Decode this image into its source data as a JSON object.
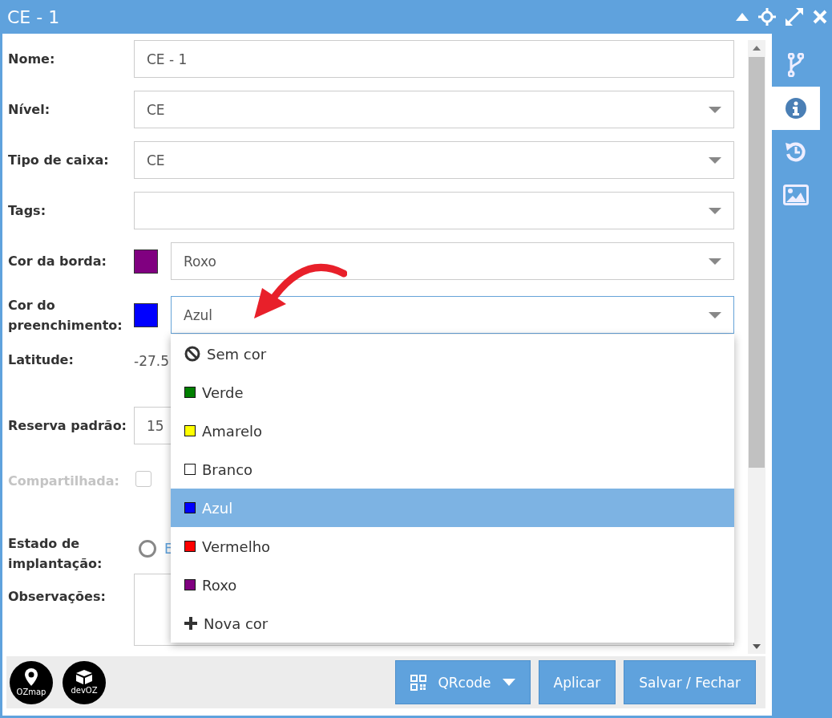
{
  "window": {
    "title": "CE - 1"
  },
  "fields": [
    {
      "label": "Nome:",
      "kind": "text",
      "value": "CE - 1"
    },
    {
      "label": "Nível:",
      "kind": "select",
      "value": "CE"
    },
    {
      "label": "Tipo de caixa:",
      "kind": "select",
      "value": "CE"
    },
    {
      "label": "Tags:",
      "kind": "select"
    },
    {
      "label": "Cor da borda:",
      "kind": "color_select",
      "color": "#800080",
      "value": "Roxo",
      "focused": false
    },
    {
      "label": "Cor do preenchimento:",
      "kind": "color_select",
      "color": "#0000ff",
      "value": "Azul",
      "focused": true
    },
    {
      "label": "Latitude:",
      "kind": "static",
      "value": "-27.5"
    },
    {
      "label": "Reserva padrão:",
      "kind": "text",
      "value": "15"
    },
    {
      "label": "Compartilhada:",
      "kind": "checkbox",
      "checked": false,
      "disabled": true
    },
    {
      "label": "Estado de implantação:",
      "kind": "radio",
      "options": [
        {
          "label": "E",
          "selected": false
        }
      ]
    },
    {
      "label": "Observações:",
      "kind": "textarea"
    }
  ],
  "dropdown": {
    "items": [
      {
        "kind": "none",
        "label": "Sem cor",
        "selected": false
      },
      {
        "kind": "color",
        "label": "Verde",
        "color": "#008000",
        "selected": false
      },
      {
        "kind": "color",
        "label": "Amarelo",
        "color": "#ffff00",
        "selected": false
      },
      {
        "kind": "color",
        "label": "Branco",
        "color": "#ffffff",
        "selected": false
      },
      {
        "kind": "color",
        "label": "Azul",
        "color": "#0000ff",
        "selected": true
      },
      {
        "kind": "color",
        "label": "Vermelho",
        "color": "#ff0000",
        "selected": false
      },
      {
        "kind": "color",
        "label": "Roxo",
        "color": "#800080",
        "selected": false
      },
      {
        "kind": "add",
        "label": "Nova cor",
        "selected": false
      }
    ]
  },
  "sidebar_tabs": [
    {
      "kind": "branch",
      "selected": false
    },
    {
      "kind": "info",
      "selected": true
    },
    {
      "kind": "history",
      "selected": false
    },
    {
      "kind": "image",
      "selected": false
    }
  ],
  "logos": [
    {
      "kind": "pin",
      "text": "OZmap"
    },
    {
      "kind": "box",
      "text": "devOZ"
    }
  ],
  "buttons": [
    {
      "kind": "qr",
      "label": "QRcode"
    },
    {
      "kind": "plain",
      "label": "Aplicar"
    },
    {
      "kind": "plain",
      "label": "Salvar / Fechar"
    }
  ]
}
